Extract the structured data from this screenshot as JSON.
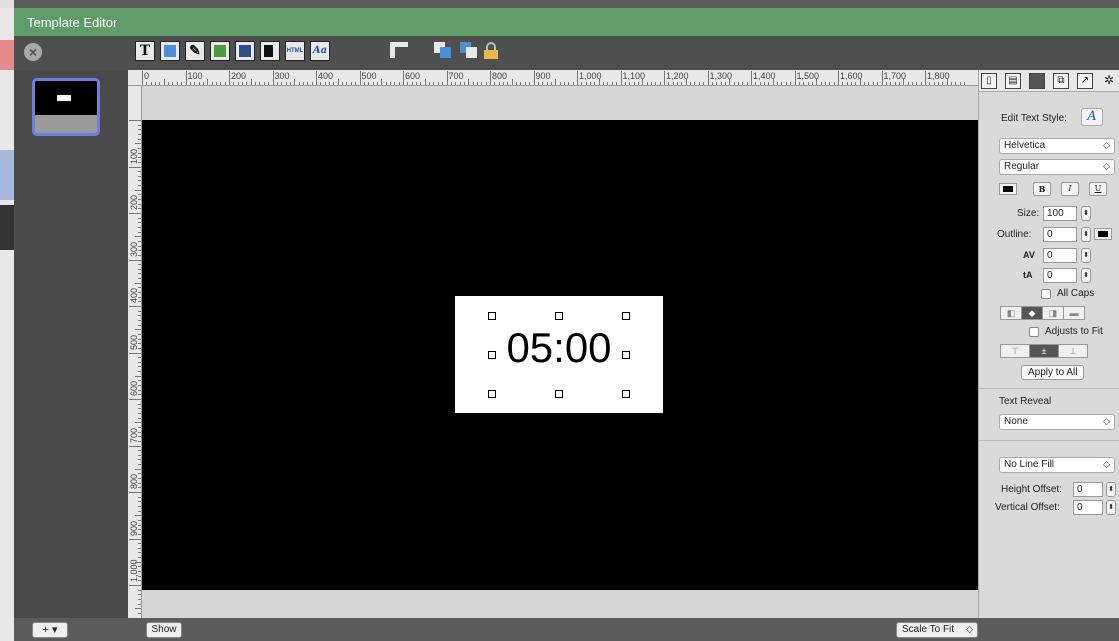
{
  "window": {
    "title": "Template Editor"
  },
  "toolbar": {
    "tools": [
      {
        "name": "text-tool",
        "glyph": "T"
      },
      {
        "name": "shape-tool",
        "glyph": ""
      },
      {
        "name": "pen-tool",
        "glyph": "✎"
      },
      {
        "name": "image-tool",
        "glyph": ""
      },
      {
        "name": "slide-tool",
        "glyph": ""
      },
      {
        "name": "video-tool",
        "glyph": "■"
      },
      {
        "name": "html-tool",
        "glyph": "HTML"
      },
      {
        "name": "text-style-tool",
        "glyph": "Aa"
      }
    ]
  },
  "ruler": {
    "top_labels": [
      "0",
      "100",
      "200",
      "300",
      "400",
      "500",
      "600",
      "700",
      "800",
      "900",
      "1,000",
      "1,100",
      "1,200",
      "1,300",
      "1,400",
      "1,500",
      "1,600",
      "1,700",
      "1,800"
    ],
    "left_labels": [
      "100",
      "200",
      "300",
      "400",
      "500",
      "600",
      "700",
      "800",
      "900",
      "1,000"
    ]
  },
  "canvas": {
    "text_value": "05:00"
  },
  "inspector": {
    "edit_text_style_label": "Edit Text Style:",
    "font_family": "Helvetica",
    "font_weight": "Regular",
    "bold": "B",
    "italic": "I",
    "underline": "U",
    "size_label": "Size:",
    "size_value": "100",
    "outline_label": "Outline:",
    "outline_value": "0",
    "kerning_value": "0",
    "baseline_value": "0",
    "all_caps_label": "All Caps",
    "adjusts_to_fit_label": "Adjusts to Fit",
    "apply_to_all_label": "Apply to All",
    "text_reveal_label": "Text Reveal",
    "text_reveal_value": "None",
    "line_fill_value": "No Line Fill",
    "height_offset_label": "Height Offset:",
    "height_offset_value": "0",
    "vertical_offset_label": "Vertical Offset:",
    "vertical_offset_value": "0"
  },
  "bottom": {
    "add_label": "+ ▾",
    "show_label": "Show",
    "scale_value": "Scale To Fit"
  }
}
